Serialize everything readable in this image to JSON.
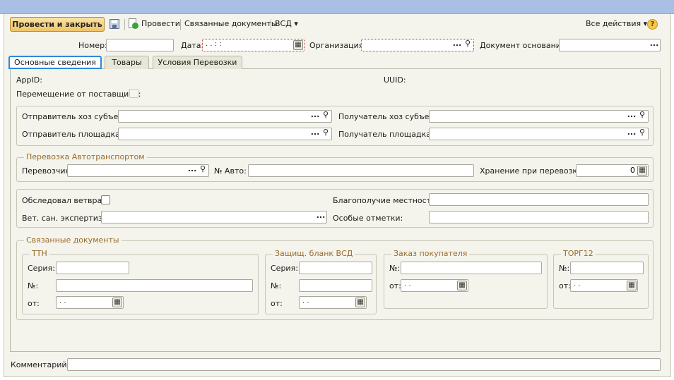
{
  "toolbar": {
    "post_close": "Провести и закрыть",
    "post": "Провести",
    "related": "Связанные документы",
    "vsd": "ВСД",
    "all_actions": "Все действия",
    "help": "?"
  },
  "header": {
    "number_label": "Номер:",
    "date_label": "Дата:",
    "date_value": " .  .       :  :",
    "org_label": "Организация:",
    "basis_label": "Документ основание:"
  },
  "tabs": [
    "Основные сведения",
    "Товары",
    "Условия Перевозки"
  ],
  "main": {
    "appid_label": "AppID:",
    "uuid_label": "UUID:",
    "from_supplier_label": "Перемещение от поставщика:",
    "sender_entity_label": "Отправитель хоз субъект:",
    "receiver_entity_label": "Получатель хоз субъект:",
    "sender_site_label": "Отправитель площадка:",
    "receiver_site_label": "Получатель площадка:"
  },
  "transport": {
    "title": "Перевозка Автотранспортом",
    "carrier_label": "Перевозчик:",
    "auto_label": "№ Авто:",
    "storage_label": "Хранение при перевозке:",
    "storage_value": "0"
  },
  "vet": {
    "examined_label": "Обследовал ветврач:",
    "welfare_label": "Благополучие местности:",
    "expertise_label": "Вет. сан. экспертиза:",
    "notes_label": "Особые отметки:"
  },
  "linked": {
    "title": "Связанные документы",
    "ttn": {
      "title": "ТТН",
      "series_label": "Серия:",
      "num_label": "№:",
      "from_label": "от:",
      "date_value": " .  ."
    },
    "vsd": {
      "title": "Защищ. бланк ВСД",
      "series_label": "Серия:",
      "num_label": "№:",
      "from_label": "от:",
      "date_value": " .  ."
    },
    "order": {
      "title": "Заказ покупателя",
      "num_label": "№:",
      "from_label": "от:",
      "date_value": " .  ."
    },
    "torg": {
      "title": "ТОРГ12",
      "num_label": "№:",
      "from_label": "от:",
      "date_value": " .  ."
    }
  },
  "comment_label": "Комментарий:",
  "icons": {
    "ellipsis": "...",
    "search": "⚲",
    "calendar": "▦",
    "dropdown": "▾"
  },
  "colors": {
    "title_bar": "#a9c0e4",
    "window_bg": "#f4f4ec",
    "group_title": "#9a6b2c",
    "tab_focus": "#2e8ad8",
    "primary_button": "#f0c466"
  }
}
